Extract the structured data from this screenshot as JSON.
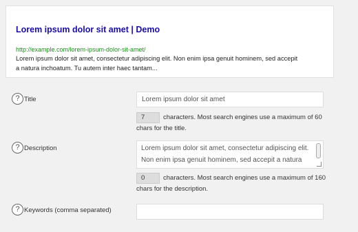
{
  "preview": {
    "title": "Lorem ipsum dolor sit amet | Demo",
    "url": "http://example.com/lorem-ipsum-dolor-sit-amet/",
    "description": "Lorem ipsum dolor sit amet, consectetur adipiscing elit. Non enim ipsa genuit hominem, sed accepit a natura inchoatum. Tu autem inter haec tantam..."
  },
  "fields": {
    "help_glyph": "?",
    "title": {
      "label": "Title",
      "value": "Lorem ipsum dolor sit amet",
      "count": "7",
      "hint": "characters. Most search engines use a maximum of 60 chars for the title."
    },
    "description": {
      "label": "Description",
      "value": "Lorem ipsum dolor sit amet, consectetur adipiscing elit. Non enim ipsa genuit hominem, sed accepit a natura",
      "count": "0",
      "hint": "characters. Most search engines use a maximum of 160 chars for the description."
    },
    "keywords": {
      "label": "Keywords (comma separated)",
      "value": ""
    }
  },
  "colors": {
    "preview_title": "#1a0dab",
    "preview_url": "#1e8e1e"
  }
}
